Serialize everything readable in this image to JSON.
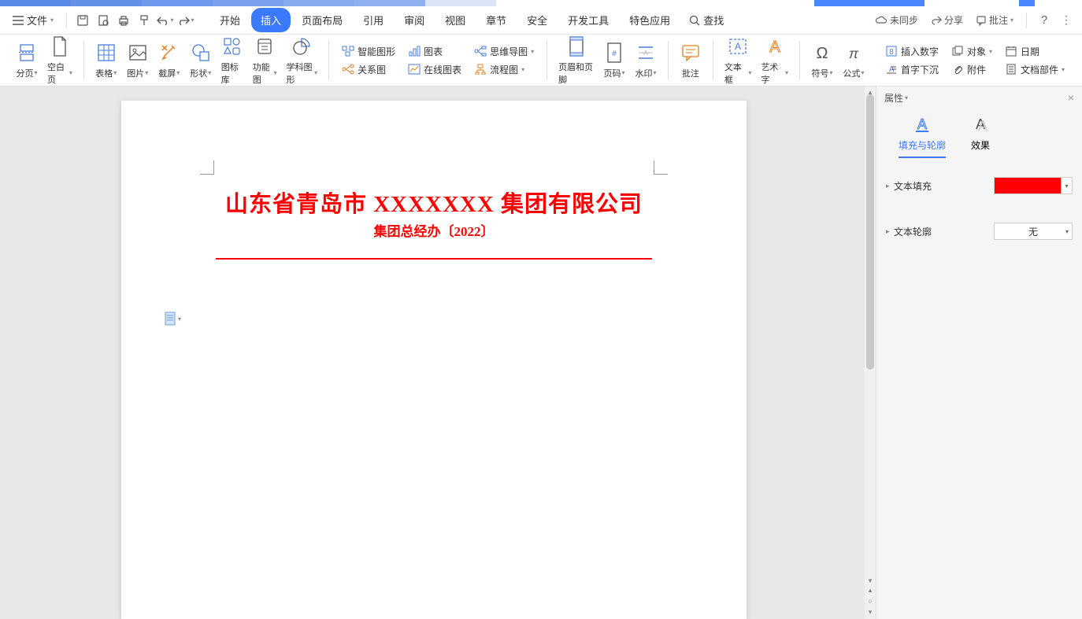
{
  "menubar": {
    "file_label": "文件",
    "tabs": [
      "开始",
      "插入",
      "页面布局",
      "引用",
      "审阅",
      "视图",
      "章节",
      "安全",
      "开发工具",
      "特色应用"
    ],
    "active_tab_index": 1,
    "search_label": "查找",
    "unsync_label": "未同步",
    "share_label": "分享",
    "annotate_label": "批注"
  },
  "ribbon": {
    "page_break": "分页",
    "blank_page": "空白页",
    "table": "表格",
    "picture": "图片",
    "screenshot": "截屏",
    "shape": "形状",
    "icon_lib": "图标库",
    "functions": "功能图",
    "subject_graphics": "学科图形",
    "smart_art": "智能图形",
    "relation": "关系图",
    "chart": "图表",
    "mindmap": "思维导图",
    "online_chart": "在线图表",
    "flowchart": "流程图",
    "header_footer": "页眉和页脚",
    "page_number": "页码",
    "watermark": "水印",
    "comment": "批注",
    "text_box": "文本框",
    "word_art": "艺术字",
    "symbol": "符号",
    "equation": "公式",
    "insert_number": "插入数字",
    "drop_cap": "首字下沉",
    "object": "对象",
    "attachment": "附件",
    "date": "日期",
    "doc_parts": "文档部件"
  },
  "document": {
    "title": "山东省青岛市 XXXXXXX 集团有限公司",
    "subtitle": "集团总经办〔2022〕"
  },
  "props": {
    "panel_title": "属性",
    "tab_fill": "填充与轮廓",
    "tab_effect": "效果",
    "text_fill_label": "文本填充",
    "text_outline_label": "文本轮廓",
    "outline_value": "无",
    "fill_color": "#ff0000"
  }
}
